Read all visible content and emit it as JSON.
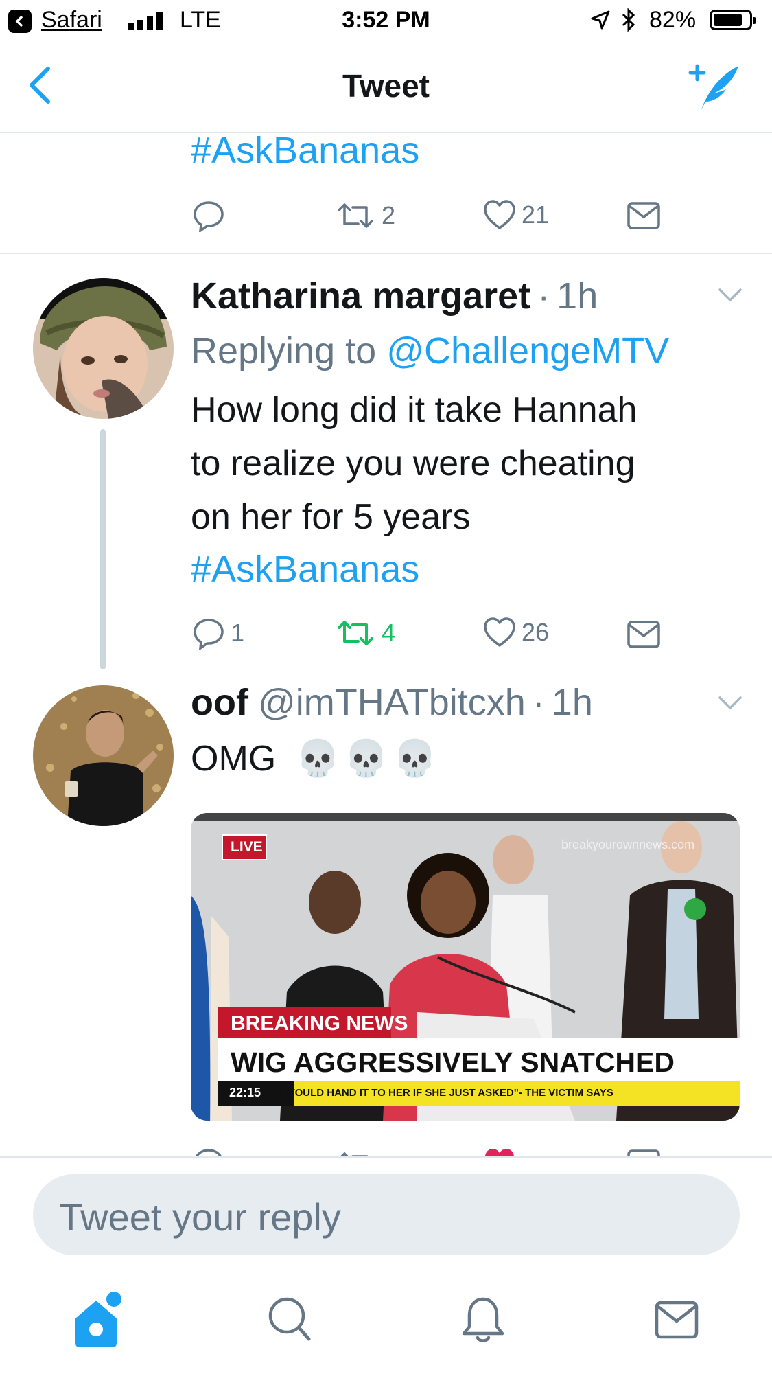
{
  "status_bar": {
    "app": "Safari",
    "network": "LTE",
    "time": "3:52 PM",
    "battery": "82%",
    "battery_level": 0.82
  },
  "nav": {
    "title": "Tweet"
  },
  "tweet_top": {
    "hashtag": "#AskBananas",
    "reply_count": "",
    "retweet_count": "2",
    "like_count": "21"
  },
  "tweet_1": {
    "name": "Katharina margaret",
    "sep": "·",
    "time": "1h",
    "replying_prefix": "Replying to",
    "replying_to": "@ChallengeMTV",
    "lines": [
      "How long did it take Hannah",
      "to realize you were cheating",
      "on her for 5 years"
    ],
    "hashtag": "#AskBananas",
    "reply_count": "1",
    "retweet_count": "4",
    "like_count": "26"
  },
  "tweet_2": {
    "name": "oof",
    "handle": "@imTHATbitcxh",
    "sep": "·",
    "time": "1h",
    "text": "OMG",
    "emoji": "💀💀💀",
    "media": {
      "live_badge": "LIVE",
      "watermark": "breakyourownnews.com",
      "breaking": "BREAKING NEWS",
      "headline": "WIG AGGRESSIVELY SNATCHED",
      "clock": "22:15",
      "ticker": "\"I WOULD HAND IT TO HER IF SHE JUST ASKED\"- THE VICTIM SAYS"
    }
  },
  "reply_box": {
    "placeholder": "Tweet your reply"
  },
  "colors": {
    "accent": "#1da1f2",
    "retweet_active": "#17bf63",
    "like_active": "#e0245e",
    "text_gray": "#657786"
  },
  "icons": [
    "back-chevron-icon",
    "compose-feather-icon",
    "reply-icon",
    "retweet-icon",
    "like-icon",
    "dm-icon",
    "home-icon",
    "search-icon",
    "bell-icon",
    "mail-icon"
  ]
}
